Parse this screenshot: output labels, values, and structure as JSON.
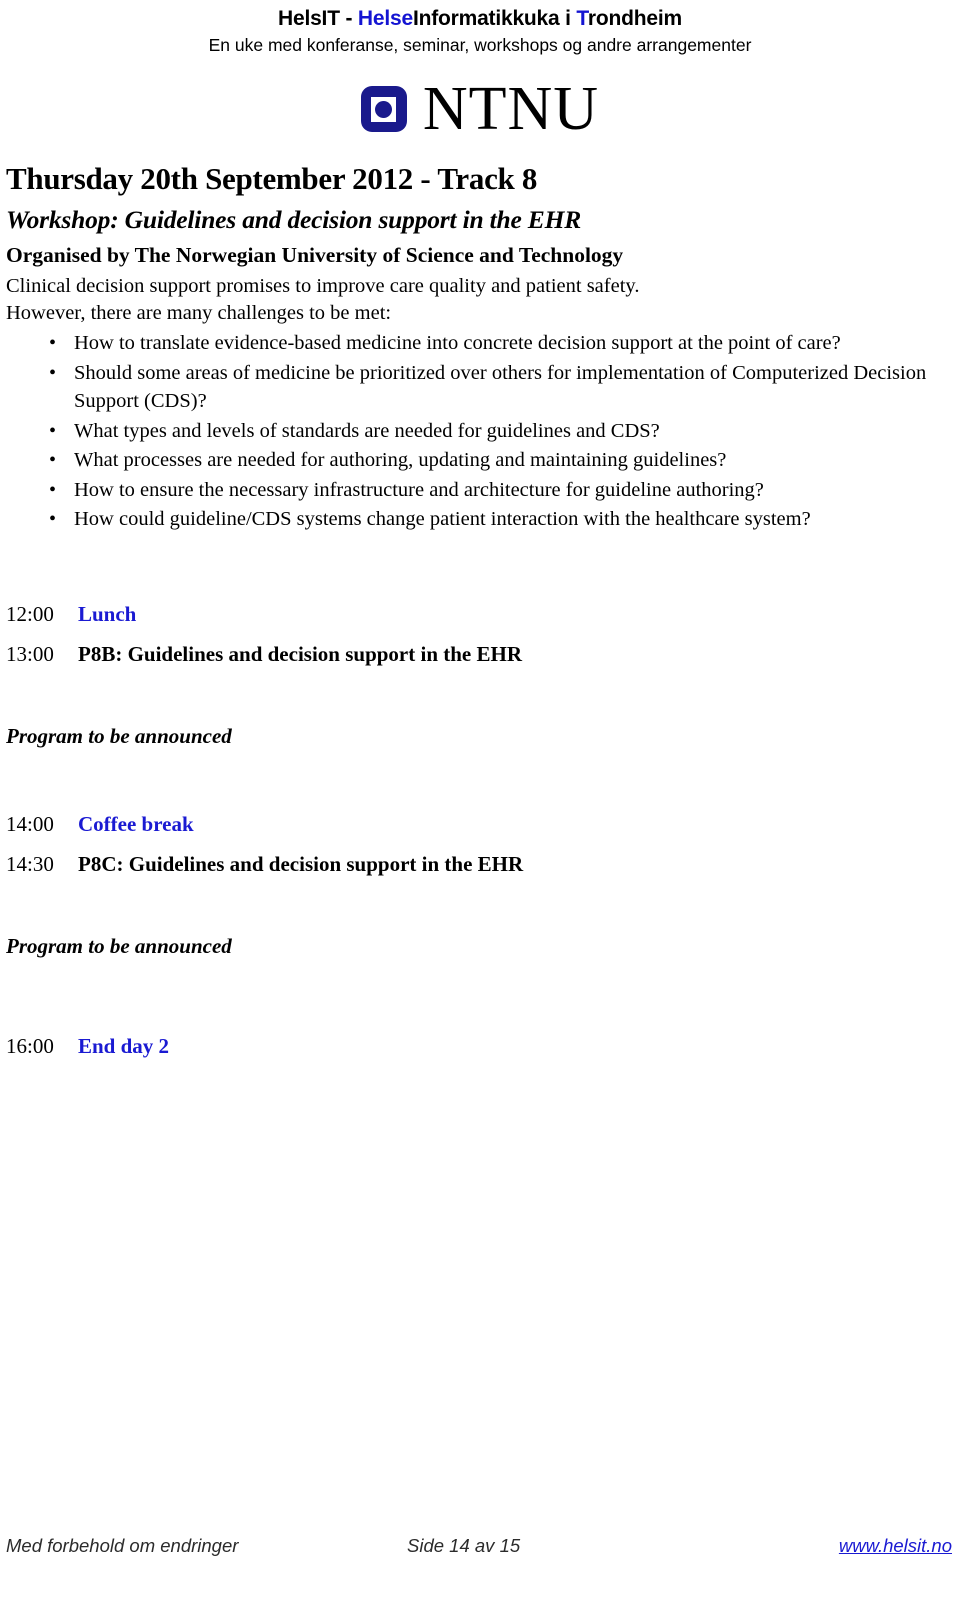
{
  "banner": {
    "title_part1": "HelsIT - ",
    "title_helse": "Helse",
    "title_part2": "Informatikkuka i ",
    "title_t": "T",
    "title_part3": "rondheim",
    "subtitle": "En uke med konferanse, seminar, workshops og andre arrangementer",
    "brand_blue": "#1414d2"
  },
  "logo": {
    "wordmark": "NTNU",
    "mark_color": "#1a1a8c"
  },
  "document": {
    "day_title": "Thursday 20th September 2012 - Track 8",
    "workshop_title": "Workshop: Guidelines and decision support in the EHR",
    "organiser": "Organised by The Norwegian University of Science and Technology",
    "intro_line1": "Clinical decision support promises to improve care quality and patient safety.",
    "intro_line2": "However, there are many challenges to be met:",
    "bullet_glyph": "•",
    "challenges": [
      "How to translate evidence-based medicine into concrete decision support at the point of care?",
      "Should some areas of medicine be prioritized over others for implementation of Computerized Decision Support (CDS)?",
      "What types and levels of standards are needed for guidelines and CDS?",
      "What processes are needed for authoring, updating and maintaining guidelines?",
      "How to ensure the necessary infrastructure and architecture for guideline authoring?",
      "How could guideline/CDS systems change patient interaction with the healthcare system?"
    ]
  },
  "schedule": {
    "items": [
      {
        "time": "12:00",
        "label": "Lunch",
        "color": "blue"
      },
      {
        "time": "13:00",
        "label": "P8B: Guidelines and decision support in the EHR",
        "color": "black"
      }
    ],
    "tba_1": "Program to be announced",
    "items2": [
      {
        "time": "14:00",
        "label": "Coffee break",
        "color": "blue"
      },
      {
        "time": "14:30",
        "label": "P8C: Guidelines and decision support in the EHR",
        "color": "black"
      }
    ],
    "tba_2": "Program to be announced",
    "items3": [
      {
        "time": "16:00",
        "label": "End day 2",
        "color": "blue"
      }
    ],
    "blue": "#1a1ad2"
  },
  "footer": {
    "left": "Med forbehold om endringer",
    "center": "Side 14 av 15",
    "right": "www.helsit.no",
    "link_color": "#1a1ad2"
  }
}
